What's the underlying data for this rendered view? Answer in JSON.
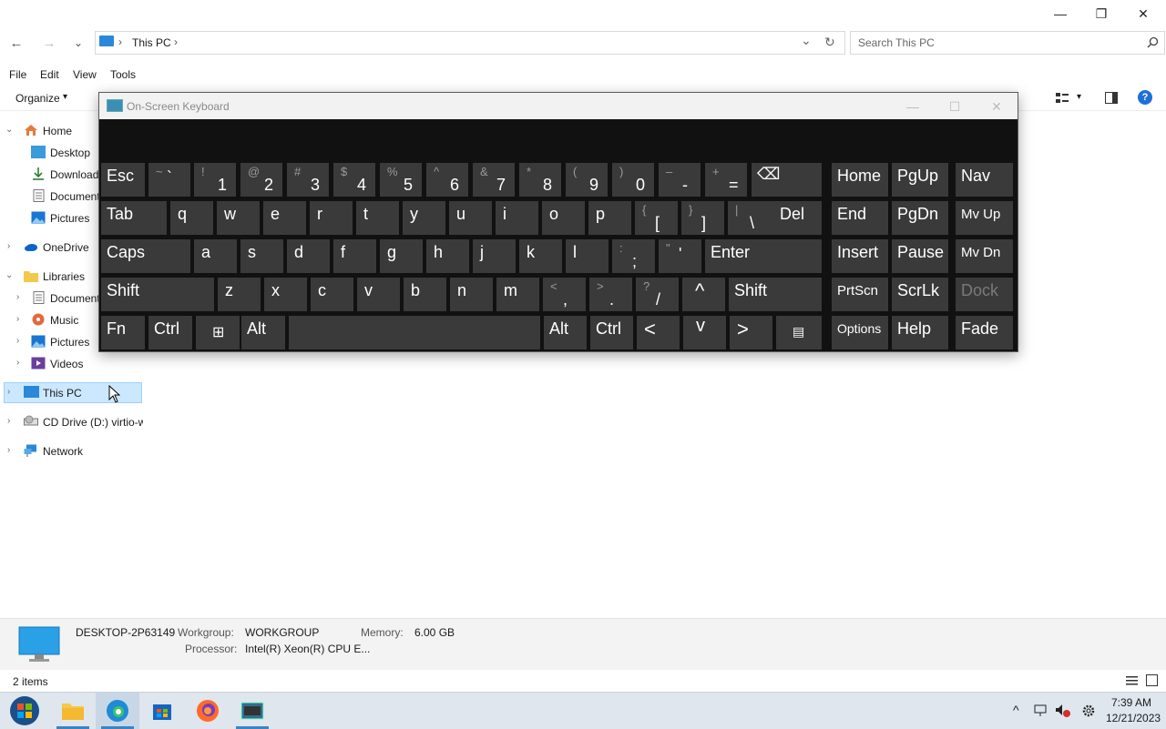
{
  "window": {
    "controls": {
      "minimize": "—",
      "maximize": "❐",
      "close": "✕"
    }
  },
  "address_bar": {
    "back": "←",
    "forward": "→",
    "recent": "⌄",
    "crumb_root_sep": "›",
    "crumb_current": "This PC",
    "crumb_after_sep": "›",
    "dropdown": "⌄",
    "refresh": "↻",
    "search_placeholder": "Search This PC",
    "search_icon": "search-icon"
  },
  "menu": {
    "file": "File",
    "edit": "Edit",
    "view": "View",
    "tools": "Tools"
  },
  "toolbar": {
    "organize": "Organize",
    "organize_caret": "▾",
    "view_caret": "▾",
    "help": "?"
  },
  "sidebar": {
    "items": [
      {
        "label": "Home",
        "expander": "⌄",
        "icon": "home-icon"
      },
      {
        "label": "Desktop",
        "expander": "",
        "icon": "desktop-icon"
      },
      {
        "label": "Downloads",
        "expander": "",
        "icon": "download-icon"
      },
      {
        "label": "Documents",
        "expander": "",
        "icon": "documents-icon"
      },
      {
        "label": "Pictures",
        "expander": "",
        "icon": "pictures-icon"
      },
      {
        "label": "OneDrive",
        "expander": "›",
        "icon": "onedrive-icon"
      },
      {
        "label": "Libraries",
        "expander": "⌄",
        "icon": "libraries-icon"
      },
      {
        "label": "Documents",
        "expander": "›",
        "icon": "documents-icon"
      },
      {
        "label": "Music",
        "expander": "›",
        "icon": "music-icon"
      },
      {
        "label": "Pictures",
        "expander": "›",
        "icon": "pictures-icon"
      },
      {
        "label": "Videos",
        "expander": "›",
        "icon": "videos-icon"
      },
      {
        "label": "This PC",
        "expander": "›",
        "icon": "this-pc-icon"
      },
      {
        "label": "CD Drive (D:) virtio-win",
        "expander": "›",
        "icon": "cd-drive-icon"
      },
      {
        "label": "Network",
        "expander": "›",
        "icon": "network-icon"
      }
    ]
  },
  "osk": {
    "title": "On-Screen Keyboard",
    "controls": {
      "minimize": "—",
      "maximize": "☐",
      "close": "✕"
    },
    "keys": {
      "esc": "Esc",
      "tilde_s": "~",
      "tilde_b": "`",
      "1_s": "!",
      "1_b": "1",
      "2_s": "@",
      "2_b": "2",
      "3_s": "#",
      "3_b": "3",
      "4_s": "$",
      "4_b": "4",
      "5_s": "%",
      "5_b": "5",
      "6_s": "^",
      "6_b": "6",
      "7_s": "&",
      "7_b": "7",
      "8_s": "*",
      "8_b": "8",
      "9_s": "(",
      "9_b": "9",
      "0_s": ")",
      "0_b": "0",
      "minus_s": "–",
      "minus_b": "-",
      "eq_s": "+",
      "eq_b": "=",
      "backspace": "⌫",
      "home": "Home",
      "pgup": "PgUp",
      "nav": "Nav",
      "tab": "Tab",
      "q": "q",
      "w": "w",
      "e": "e",
      "r": "r",
      "t": "t",
      "y": "y",
      "u": "u",
      "i": "i",
      "o": "o",
      "p": "p",
      "lbr_s": "{",
      "lbr_b": "[",
      "rbr_s": "}",
      "rbr_b": "]",
      "bs_s": "|",
      "bs_b": "\\",
      "del": "Del",
      "end": "End",
      "pgdn": "PgDn",
      "mvup": "Mv Up",
      "caps": "Caps",
      "a": "a",
      "s": "s",
      "d": "d",
      "f": "f",
      "g": "g",
      "h": "h",
      "j": "j",
      "k": "k",
      "l": "l",
      "semi_s": ":",
      "semi_b": ";",
      "quote_s": "\"",
      "quote_b": "'",
      "enter": "Enter",
      "insert": "Insert",
      "pause": "Pause",
      "mvdn": "Mv Dn",
      "shift": "Shift",
      "z": "z",
      "x": "x",
      "c": "c",
      "v": "v",
      "b": "b",
      "n": "n",
      "m": "m",
      "comma_s": "<",
      "comma_b": ",",
      "period_s": ">",
      "period_b": ".",
      "slash_s": "?",
      "slash_b": "/",
      "up": "^",
      "shift_r": "Shift",
      "prtscn": "PrtScn",
      "scrlk": "ScrLk",
      "dock": "Dock",
      "fn": "Fn",
      "ctrl": "Ctrl",
      "win": "⊞",
      "alt": "Alt",
      "alt_r": "Alt",
      "ctrl_r": "Ctrl",
      "left": "<",
      "down": "v",
      "right": ">",
      "menu": "▤",
      "options": "Options",
      "help": "Help",
      "fade": "Fade"
    }
  },
  "details": {
    "computer_name": "DESKTOP-2P63149",
    "workgroup_label": "Workgroup:",
    "workgroup_value": "WORKGROUP",
    "memory_label": "Memory:",
    "memory_value": "6.00 GB",
    "processor_label": "Processor:",
    "processor_value": "Intel(R) Xeon(R) CPU E..."
  },
  "status": {
    "items": "2 items"
  },
  "taskbar": {
    "time": "7:39 AM",
    "date": "12/21/2023",
    "tray_up": "^"
  }
}
